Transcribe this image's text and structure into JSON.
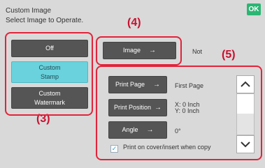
{
  "header": {
    "title": "Custom Image",
    "subtitle": "Select Image to Operate.",
    "ok_label": "OK"
  },
  "callouts": {
    "c3": "(3)",
    "c4": "(4)",
    "c5": "(5)"
  },
  "left_panel": {
    "items": [
      {
        "label": "Off",
        "selected": false
      },
      {
        "label": "Custom\nStamp",
        "selected": true
      },
      {
        "label": "Custom\nWatermark",
        "selected": false
      }
    ]
  },
  "image_row": {
    "button_label": "Image",
    "value": "Not"
  },
  "settings": {
    "print_page": {
      "label": "Print Page",
      "value": "First Page"
    },
    "print_position": {
      "label": "Print Position",
      "x_value": "X: 0 Inch",
      "y_value": "Y: 0 Inch"
    },
    "angle": {
      "label": "Angle",
      "value": "0°"
    },
    "checkbox_label": "Print on cover/insert when copy"
  },
  "colors": {
    "accent_selected": "#6ad2dc",
    "ok_green": "#2bb673",
    "callout_red": "#e2233a"
  }
}
